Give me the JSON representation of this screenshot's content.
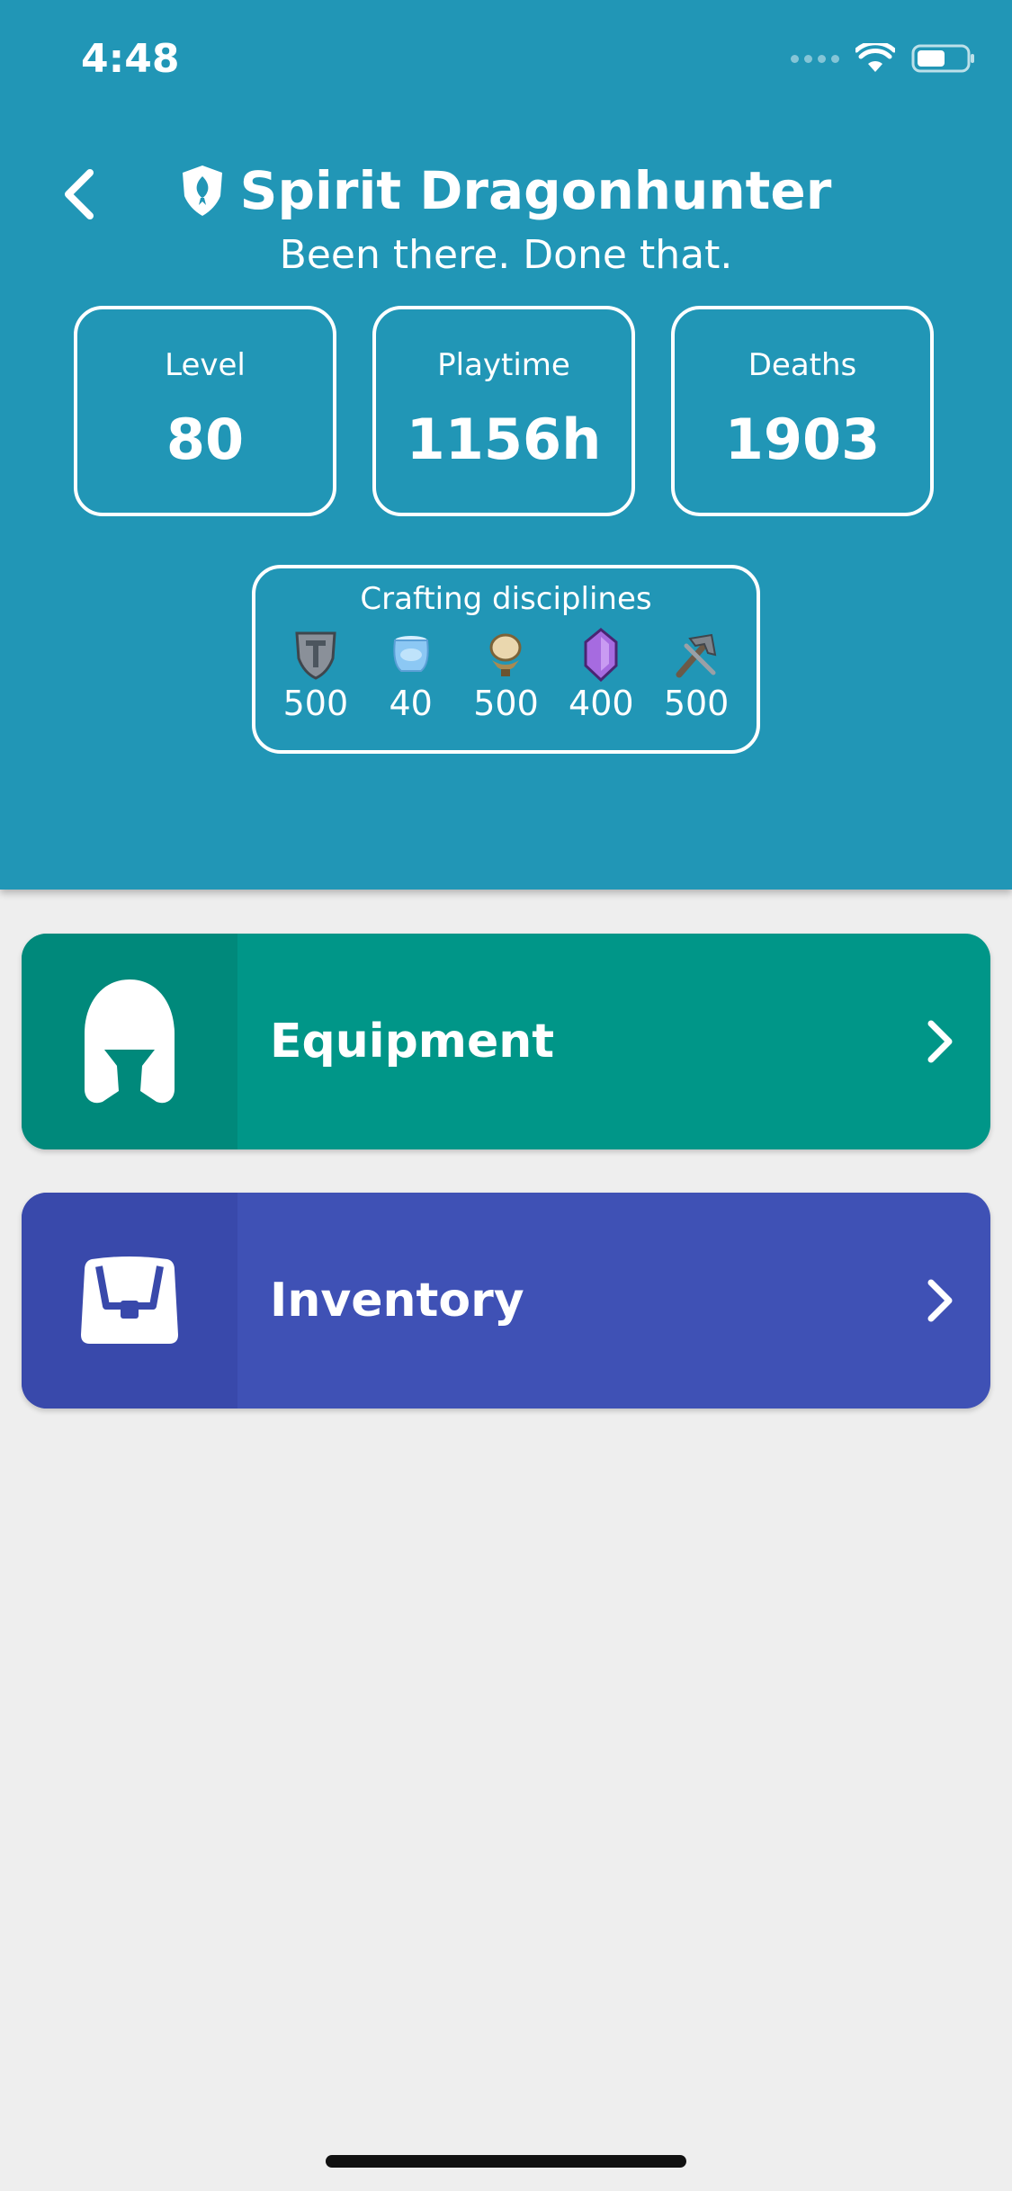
{
  "status_bar": {
    "time": "4:48"
  },
  "header": {
    "title": "Spirit Dragonhunter",
    "subtitle": "Been there. Done that."
  },
  "stats": [
    {
      "label": "Level",
      "value": "80"
    },
    {
      "label": "Playtime",
      "value": "1156h"
    },
    {
      "label": "Deaths",
      "value": "1903"
    }
  ],
  "crafting": {
    "title": "Crafting disciplines",
    "items": [
      {
        "icon": "armorsmith-icon",
        "level": "500"
      },
      {
        "icon": "cook-icon",
        "level": "40"
      },
      {
        "icon": "tailor-icon",
        "level": "500"
      },
      {
        "icon": "jeweler-icon",
        "level": "400"
      },
      {
        "icon": "weaponsmith-icon",
        "level": "500"
      }
    ]
  },
  "menu": {
    "equipment_label": "Equipment",
    "inventory_label": "Inventory"
  },
  "colors": {
    "header": "#2196B6",
    "equipment": "#009688",
    "equipment_icon_bg": "#00897B",
    "inventory": "#3F51B5",
    "inventory_icon_bg": "#3949AB",
    "background": "#EEEEEE"
  }
}
